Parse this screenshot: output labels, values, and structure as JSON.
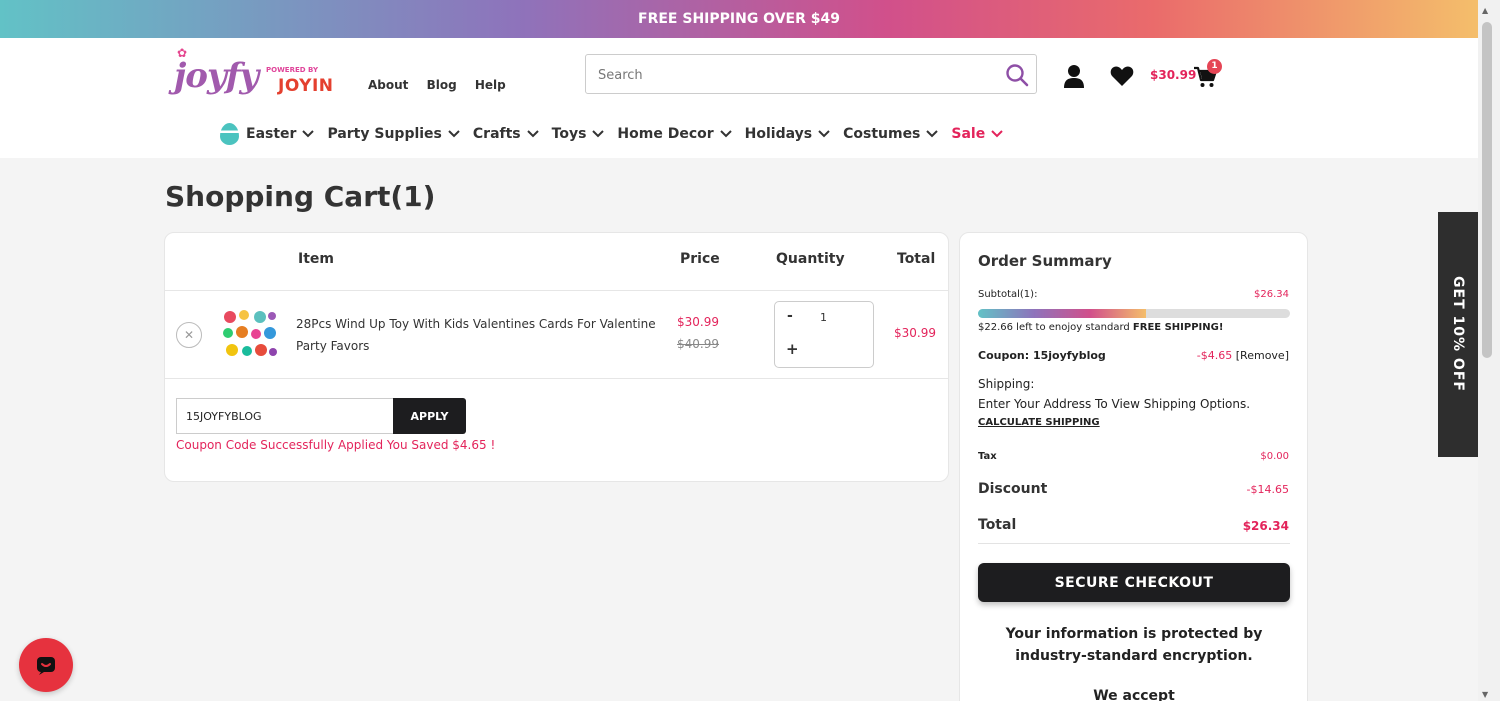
{
  "promo": {
    "text": "FREE SHIPPING OVER $49"
  },
  "logo": {
    "main": "joyfy",
    "powered": "POWERED BY",
    "sub": "JOYIN"
  },
  "top_links": [
    "About",
    "Blog",
    "Help"
  ],
  "search": {
    "placeholder": "Search",
    "value": ""
  },
  "cart": {
    "price": "$30.99",
    "count": "1"
  },
  "nav": [
    {
      "label": "Easter"
    },
    {
      "label": "Party Supplies"
    },
    {
      "label": "Crafts"
    },
    {
      "label": "Toys"
    },
    {
      "label": "Home Decor"
    },
    {
      "label": "Holidays"
    },
    {
      "label": "Costumes"
    },
    {
      "label": "Sale"
    }
  ],
  "page_title": "Shopping Cart(1)",
  "cart_table": {
    "headers": {
      "item": "Item",
      "price": "Price",
      "quantity": "Quantity",
      "total": "Total"
    },
    "rows": [
      {
        "name": "28Pcs Wind Up Toy With Kids Valentines Cards For Valentine Party Favors",
        "price_sale": "$30.99",
        "price_original": "$40.99",
        "quantity": "1",
        "total": "$30.99"
      }
    ]
  },
  "coupon": {
    "value": "15JOYFYBLOG",
    "apply_label": "APPLY",
    "message": "Coupon Code Successfully Applied You Saved $4.65 !"
  },
  "summary": {
    "title": "Order Summary",
    "subtotal_label": "Subtotal(1):",
    "subtotal_value": "$26.34",
    "progress_fraction": 0.54,
    "free_shipping_amount": "$22.66",
    "free_shipping_mid": " left to enojoy standard ",
    "free_shipping_bold": "FREE SHIPPING!",
    "coupon_label": "Coupon: 15joyfyblog",
    "coupon_value": "-$4.65",
    "coupon_remove": "[Remove]",
    "shipping_label": "Shipping:",
    "shipping_text": "Enter Your Address To View Shipping Options.",
    "calculate_shipping": "CALCULATE SHIPPING",
    "tax_label": "Tax",
    "tax_value": "$0.00",
    "discount_label": "Discount",
    "discount_value": "-$14.65",
    "total_label": "Total",
    "total_value": "$26.34",
    "checkout_label": "SECURE CHECKOUT",
    "protect_line1": "Your information is protected by",
    "protect_line2": "industry-standard encryption.",
    "accept_label": "We accept"
  },
  "side_tab": {
    "label": "GET 10% OFF"
  },
  "colors": {
    "accent": "#e3245b",
    "dark": "#1d1d1f",
    "brand_purple": "#a15aad"
  }
}
